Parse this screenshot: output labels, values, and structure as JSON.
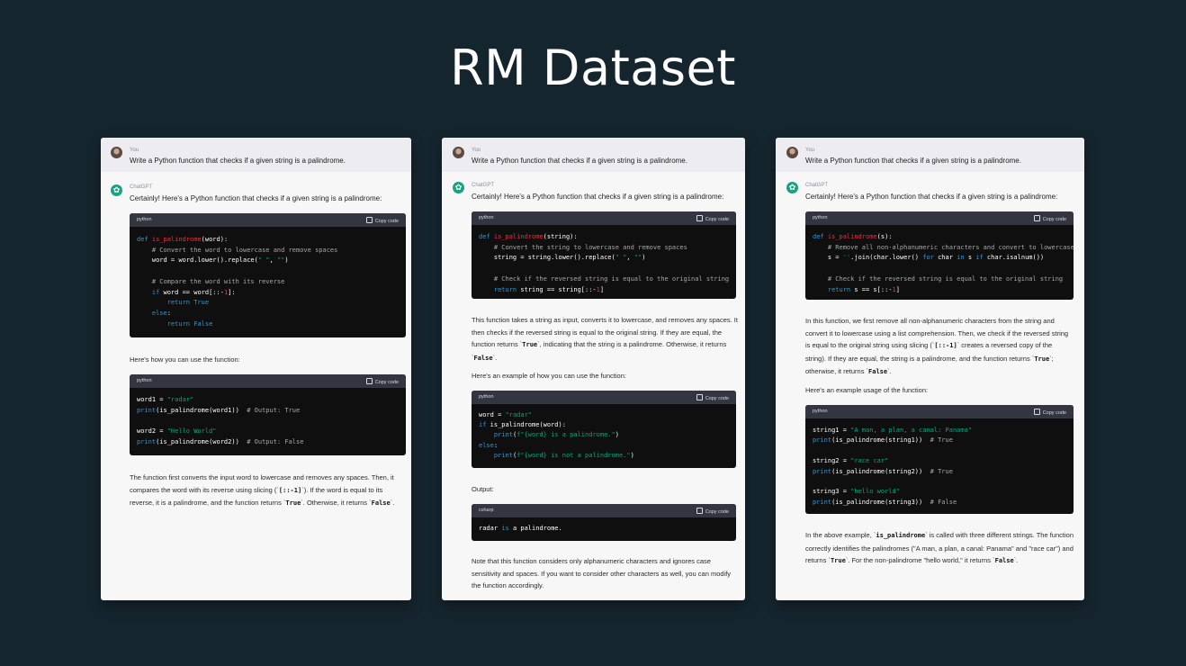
{
  "page": {
    "title": "RM Dataset"
  },
  "prompt": "Write a Python function that checks if a given string is a palindrome.",
  "labels": {
    "user": "You",
    "assistant": "ChatGPT",
    "intro": "Certainly! Here's a Python function that checks if a given string is a palindrome:",
    "copy": "Copy code"
  },
  "panels": [
    {
      "blocks": [
        {
          "type": "code",
          "lang": "python",
          "code": [
            [
              [
                "kw",
                "def "
              ],
              [
                "fn",
                "is_palindrome"
              ],
              [
                "",
                "(word):"
              ]
            ],
            [
              [
                "cm",
                "    # Convert the word to lowercase and remove spaces"
              ]
            ],
            [
              [
                "",
                "    word = word.lower().replace("
              ],
              [
                "str",
                "\" \""
              ],
              [
                "",
                ", "
              ],
              [
                "str",
                "\"\""
              ],
              [
                "",
                ")"
              ]
            ],
            [],
            [
              [
                "cm",
                "    # Compare the word with its reverse"
              ]
            ],
            [
              [
                "kw",
                "    if "
              ],
              [
                "",
                "word == word[::-"
              ],
              [
                "num",
                "1"
              ],
              [
                "",
                "]:"
              ]
            ],
            [
              [
                "kw",
                "        return True"
              ]
            ],
            [
              [
                "kw",
                "    else"
              ],
              [
                "",
                ":"
              ]
            ],
            [
              [
                "kw",
                "        return False"
              ]
            ]
          ]
        },
        {
          "type": "text",
          "parts": [
            [
              "",
              "Here's how you can use the function:"
            ]
          ]
        },
        {
          "type": "code",
          "lang": "python",
          "code": [
            [
              [
                "",
                "word1 = "
              ],
              [
                "str",
                "\"radar\""
              ]
            ],
            [
              [
                "kw",
                "print"
              ],
              [
                "",
                "(is_palindrome(word1))  "
              ],
              [
                "cm",
                "# Output: True"
              ]
            ],
            [],
            [
              [
                "",
                "word2 = "
              ],
              [
                "str",
                "\"Hello World\""
              ]
            ],
            [
              [
                "kw",
                "print"
              ],
              [
                "",
                "(is_palindrome(word2))  "
              ],
              [
                "cm",
                "# Output: False"
              ]
            ]
          ]
        },
        {
          "type": "text",
          "parts": [
            [
              "",
              "The function first converts the input word to lowercase and removes any spaces. Then, it compares the word with its reverse using slicing (`"
            ],
            [
              "ic",
              "[::-1]"
            ],
            [
              "",
              "`). If the word is equal to its reverse, it is a palindrome, and the function returns `"
            ],
            [
              "ic",
              "True"
            ],
            [
              "",
              "`. Otherwise, it returns `"
            ],
            [
              "ic",
              "False"
            ],
            [
              "",
              "`."
            ]
          ]
        }
      ]
    },
    {
      "blocks": [
        {
          "type": "code",
          "lang": "python",
          "code": [
            [
              [
                "kw",
                "def "
              ],
              [
                "fn",
                "is_palindrome"
              ],
              [
                "",
                "(string):"
              ]
            ],
            [
              [
                "cm",
                "    # Convert the string to lowercase and remove spaces"
              ]
            ],
            [
              [
                "",
                "    string = string.lower().replace("
              ],
              [
                "str",
                "\" \""
              ],
              [
                "",
                ", "
              ],
              [
                "str",
                "\"\""
              ],
              [
                "",
                ")"
              ]
            ],
            [],
            [
              [
                "cm",
                "    # Check if the reversed string is equal to the original string"
              ]
            ],
            [
              [
                "kw",
                "    return "
              ],
              [
                "",
                "string == string[::-"
              ],
              [
                "num",
                "1"
              ],
              [
                "",
                "]"
              ]
            ]
          ]
        },
        {
          "type": "text",
          "parts": [
            [
              "",
              "This function takes a string as input, converts it to lowercase, and removes any spaces. It then checks if the reversed string is equal to the original string. If they are equal, the function returns `"
            ],
            [
              "ic",
              "True"
            ],
            [
              "",
              "`, indicating that the string is a palindrome. Otherwise, it returns `"
            ],
            [
              "ic",
              "False"
            ],
            [
              "",
              "`."
            ]
          ]
        },
        {
          "type": "text",
          "parts": [
            [
              "",
              "Here's an example of how you can use the function:"
            ]
          ]
        },
        {
          "type": "code",
          "lang": "python",
          "code": [
            [
              [
                "",
                "word = "
              ],
              [
                "str",
                "\"radar\""
              ]
            ],
            [
              [
                "kw",
                "if "
              ],
              [
                "",
                "is_palindrome(word):"
              ]
            ],
            [
              [
                "kw",
                "    print"
              ],
              [
                "",
                "("
              ],
              [
                "str",
                "f\"{word} is a palindrome.\""
              ],
              [
                "",
                ")"
              ]
            ],
            [
              [
                "kw",
                "else"
              ],
              [
                "",
                ":"
              ]
            ],
            [
              [
                "kw",
                "    print"
              ],
              [
                "",
                "("
              ],
              [
                "str",
                "f\"{word} is not a palindrome.\""
              ],
              [
                "",
                ")"
              ]
            ]
          ]
        },
        {
          "type": "text",
          "parts": [
            [
              "",
              "Output:"
            ]
          ]
        },
        {
          "type": "code",
          "lang": "csharp",
          "code": [
            [
              [
                "",
                "radar "
              ],
              [
                "kw",
                "is"
              ],
              [
                "",
                " a palindrome."
              ]
            ]
          ]
        },
        {
          "type": "text",
          "parts": [
            [
              "",
              "Note that this function considers only alphanumeric characters and ignores case sensitivity and spaces. If you want to consider other characters as well, you can modify the function accordingly."
            ]
          ]
        }
      ]
    },
    {
      "blocks": [
        {
          "type": "code",
          "lang": "python",
          "code": [
            [
              [
                "kw",
                "def "
              ],
              [
                "fn",
                "is_palindrome"
              ],
              [
                "",
                "(s):"
              ]
            ],
            [
              [
                "cm",
                "    # Remove all non-alphanumeric characters and convert to lowercase"
              ]
            ],
            [
              [
                "",
                "    s = "
              ],
              [
                "str",
                "''"
              ],
              [
                "",
                ".join(char.lower() "
              ],
              [
                "kw",
                "for "
              ],
              [
                "",
                "char "
              ],
              [
                "kw",
                "in "
              ],
              [
                "",
                "s "
              ],
              [
                "kw",
                "if "
              ],
              [
                "",
                "char.isalnum())"
              ]
            ],
            [],
            [
              [
                "cm",
                "    # Check if the reversed string is equal to the original string"
              ]
            ],
            [
              [
                "kw",
                "    return "
              ],
              [
                "",
                "s == s[::-"
              ],
              [
                "num",
                "1"
              ],
              [
                "",
                "]"
              ]
            ]
          ]
        },
        {
          "type": "text",
          "parts": [
            [
              "",
              "In this function, we first remove all non-alphanumeric characters from the string and convert it to lowercase using a list comprehension. Then, we check if the reversed string is equal to the original string using slicing (`"
            ],
            [
              "ic",
              "[::-1]"
            ],
            [
              "",
              "` creates a reversed copy of the string). If they are equal, the string is a palindrome, and the function returns `"
            ],
            [
              "ic",
              "True"
            ],
            [
              "",
              "`; otherwise, it returns `"
            ],
            [
              "ic",
              "False"
            ],
            [
              "",
              "`."
            ]
          ]
        },
        {
          "type": "text",
          "parts": [
            [
              "",
              "Here's an example usage of the function:"
            ]
          ]
        },
        {
          "type": "code",
          "lang": "python",
          "code": [
            [
              [
                "",
                "string1 = "
              ],
              [
                "str",
                "\"A man, a plan, a canal: Panama\""
              ]
            ],
            [
              [
                "kw",
                "print"
              ],
              [
                "",
                "(is_palindrome(string1))  "
              ],
              [
                "cm",
                "# True"
              ]
            ],
            [],
            [
              [
                "",
                "string2 = "
              ],
              [
                "str",
                "\"race car\""
              ]
            ],
            [
              [
                "kw",
                "print"
              ],
              [
                "",
                "(is_palindrome(string2))  "
              ],
              [
                "cm",
                "# True"
              ]
            ],
            [],
            [
              [
                "",
                "string3 = "
              ],
              [
                "str",
                "\"hello world\""
              ]
            ],
            [
              [
                "kw",
                "print"
              ],
              [
                "",
                "(is_palindrome(string3))  "
              ],
              [
                "cm",
                "# False"
              ]
            ]
          ]
        },
        {
          "type": "text",
          "parts": [
            [
              "",
              "In the above example, `"
            ],
            [
              "ic",
              "is_palindrome"
            ],
            [
              "",
              "` is called with three different strings. The function correctly identifies the palindromes (\"A man, a plan, a canal: Panama\" and \"race car\") and returns `"
            ],
            [
              "ic",
              "True"
            ],
            [
              "",
              "`. For the non-palindrome \"hello world,\" it returns `"
            ],
            [
              "ic",
              "False"
            ],
            [
              "",
              "`."
            ]
          ]
        }
      ]
    }
  ]
}
